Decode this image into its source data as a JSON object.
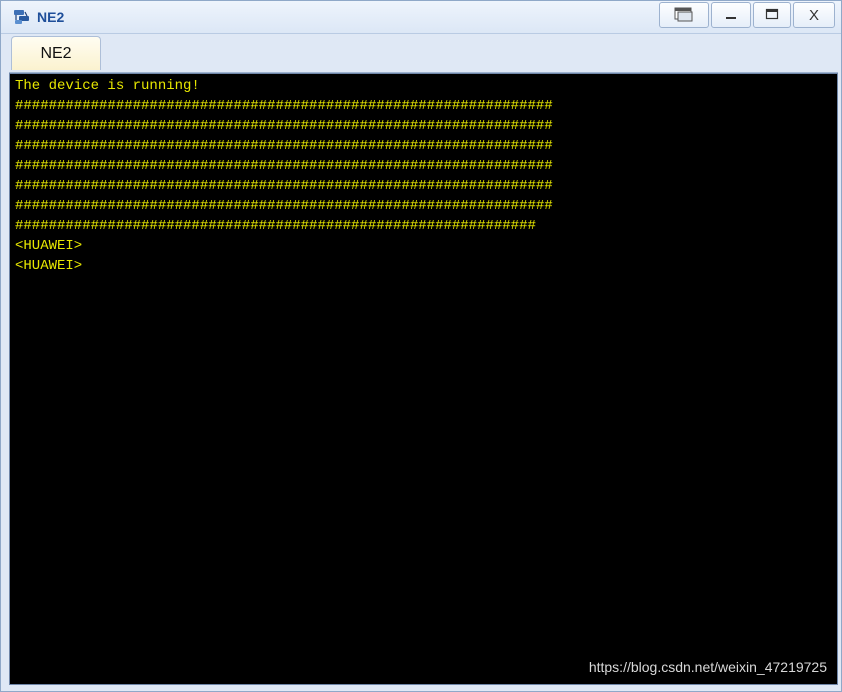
{
  "window": {
    "title": "NE2",
    "buttons": {
      "restore_icon": "restore-window-icon",
      "minimize_icon": "minimize-icon",
      "maximize_icon": "maximize-icon",
      "close_label": "X"
    }
  },
  "tabs": [
    {
      "label": "NE2",
      "active": true
    }
  ],
  "terminal": {
    "text_color": "#e8e800",
    "background": "#000000",
    "lines": [
      "The device is running!",
      "################################################################",
      "################################################################",
      "################################################################",
      "################################################################",
      "################################################################",
      "################################################################",
      "##############################################################",
      "<HUAWEI>",
      "<HUAWEI>"
    ]
  },
  "watermark": "https://blog.csdn.net/weixin_47219725"
}
